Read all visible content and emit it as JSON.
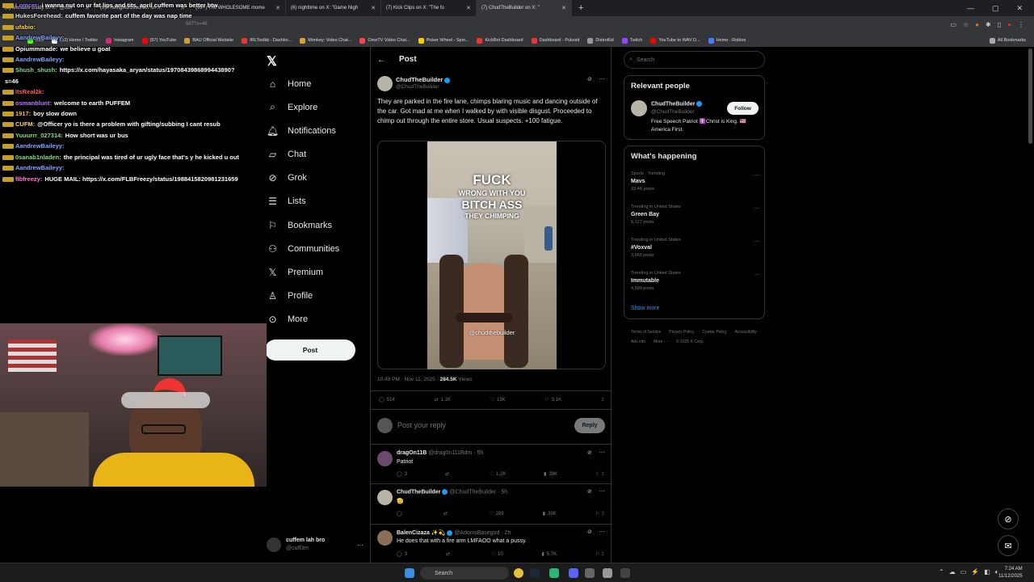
{
  "browser": {
    "tabs": [
      {
        "label": "(6) Mohawk Diddy on X: \"@cuff"
      },
      {
        "label": "(6) ThebigMD15burner on X: \""
      },
      {
        "label": "(99+) The WHOLESOME mome"
      },
      {
        "label": "(6) nighttime on X: \"Game Nigh"
      },
      {
        "label": "(7) Kick Clips on X: \"The fo"
      },
      {
        "label": "(7) ChudTheBuilder on X: \""
      }
    ],
    "bookmarks": [
      "Kick",
      "(12) Home / Twitter",
      "Instagram",
      "(57) YouTube",
      "BAU Official Website",
      "IRLToolkit - Dashbo...",
      "Monkey: Video Chat...",
      "OmeTV Video Chat...",
      "Picker Wheel - Spin...",
      "KickBot Dashboard",
      "Dashboard - Pulsoid",
      "DistroKid",
      "Twitch",
      "YouTube to WAV D...",
      "Home - Roblox"
    ],
    "all_bookmarks": "All Bookmarks",
    "url_fragment": "587?s=46"
  },
  "chat": [
    {
      "user": "Lomcer:",
      "text": "i wanna nut on ur fat lips and tits, april cuffem was better btw",
      "color": "#9b7bff"
    },
    {
      "user": "HukesForehead:",
      "text": "cuffem favorite part of the day was nap time",
      "color": "#e0e0e0"
    },
    {
      "user": "ufabio:",
      "text": "",
      "color": "#ffd84a"
    },
    {
      "user": "AandrewBaileyy:",
      "text": "",
      "color": "#7ea7ff"
    },
    {
      "user": "Opiummmade:",
      "text": "we believe u goat",
      "color": "#fff"
    },
    {
      "user": "AandrewBaileyy:",
      "text": "",
      "color": "#7ea7ff"
    },
    {
      "user": "Shush_shush:",
      "text": "https://x.com/hayasaka_aryan/status/1970843986899443890?",
      "color": "#7ee07e"
    },
    {
      "user": "",
      "text": "s=46",
      "color": "#fff"
    },
    {
      "user": "ItsReal2k:",
      "text": "",
      "color": "#ff5a5a"
    },
    {
      "user": "osmanblunt:",
      "text": "welcome to earth PUFFEM",
      "color": "#b57bff"
    },
    {
      "user": "1917:",
      "text": "boy slow down",
      "color": "#ffb347"
    },
    {
      "user": "CUFM:",
      "text": "@Officer yo is there a problem with gifting/subbing I cant resub",
      "color": "#ffd84a"
    },
    {
      "user": "Yuuurrr_027314:",
      "text": "How short was ur bus",
      "color": "#7ee07e"
    },
    {
      "user": "AandrewBaileyy:",
      "text": "",
      "color": "#7ea7ff"
    },
    {
      "user": "0sanab1nladen:",
      "text": "the principal was tired of ur ugly face that's y he kicked u out",
      "color": "#7ee07e"
    },
    {
      "user": "AandrewBaileyy:",
      "text": "",
      "color": "#7ea7ff"
    },
    {
      "user": "flbfreezy:",
      "text": "HUGE MAIL: https://x.com/FLBFreezy/status/1988415820981231659",
      "color": "#ff7bd5"
    }
  ],
  "nav": {
    "items": [
      "Home",
      "Explore",
      "Notifications",
      "Chat",
      "Grok",
      "Lists",
      "Bookmarks",
      "Communities",
      "Premium",
      "Profile",
      "More"
    ],
    "post_button": "Post",
    "account_name": "cuffem lah bro",
    "account_handle": "@cuff3m"
  },
  "post": {
    "header": "Post",
    "author": "ChudTheBuilder",
    "handle": "@ChudTheBuilder",
    "text": "They are parked in the fire lane, chimps blaring music and dancing outside of the car. Got mad at me when I walked by with visible disgust. Proceeded to chimp out through the entire store. Usual suspects. +100 fatigue.",
    "image_caption_lines": [
      "FUCK",
      "WRONG WITH YOU",
      "BITCH ASS",
      "THEY CHIMPING"
    ],
    "watermark": "@chudthebuilder",
    "time": "10:49 PM · Nov 11, 2025 ·",
    "views": "284.5K",
    "views_label": "Views",
    "replies": "514",
    "reposts": "1.1K",
    "likes": "13K",
    "bookmarks": "3.1K",
    "reply_placeholder": "Post your reply",
    "reply_button": "Reply"
  },
  "replies": [
    {
      "name": "dragOn11B",
      "handle": "@drag0n111Bdm · 5h",
      "text": "Patriot",
      "comments": "3",
      "reposts": "",
      "likes": "1.2K",
      "views": "39K"
    },
    {
      "name": "ChudTheBuilder",
      "handle": "@ChudTheBuilder · 5h",
      "text": "🫡",
      "comments": "",
      "reposts": "",
      "likes": "289",
      "views": "39K"
    },
    {
      "name": "BalenCizaza ✨💫",
      "handle": "@AdonisBasegod · 2h",
      "text": "He does that with a fire arm LMFAOO what a pussy.",
      "comments": "3",
      "reposts": "",
      "likes": "10",
      "views": "5.7K"
    }
  ],
  "right": {
    "search_placeholder": "Search",
    "relevant_title": "Relevant people",
    "person_name": "ChudTheBuilder",
    "person_handle": "@ChudTheBuilder",
    "person_bio": "Free Speech Patriot ☦️Christ is King. 🇺🇸America First.",
    "follow": "Follow",
    "happening_title": "What's happening",
    "trends": [
      {
        "category": "Sports · Trending",
        "name": "Mavs",
        "count": "33.4K posts"
      },
      {
        "category": "Trending in United States",
        "name": "Green Bay",
        "count": "5,127 posts"
      },
      {
        "category": "Trending in United States",
        "name": "#Voxval",
        "count": "3,666 posts"
      },
      {
        "category": "Trending in United States",
        "name": "Immutable",
        "count": "4,599 posts"
      }
    ],
    "show_more": "Show more",
    "footer": [
      "Terms of Service",
      "Privacy Policy",
      "Cookie Policy",
      "Accessibility",
      "Ads info",
      "More ···",
      "© 2025 X Corp."
    ]
  },
  "taskbar": {
    "search": "Search",
    "time": "7:24 AM",
    "date": "11/12/2025"
  },
  "colors": {
    "accent": "#1d9bf0",
    "bg": "#000000",
    "border": "#2f3336"
  }
}
